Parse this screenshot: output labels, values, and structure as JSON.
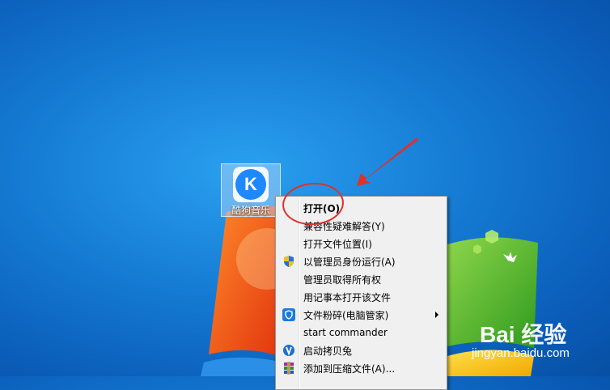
{
  "desktop": {
    "icon_label": "酷狗音乐",
    "icon_letter": "K"
  },
  "context_menu": {
    "items": [
      {
        "label": "打开(O)",
        "icon": "none",
        "bold": true
      },
      {
        "label": "兼容性疑难解答(Y)",
        "icon": "none"
      },
      {
        "label": "打开文件位置(I)",
        "icon": "none"
      },
      {
        "label": "以管理员身份运行(A)",
        "icon": "uac-shield-icon"
      },
      {
        "label": "管理员取得所有权",
        "icon": "none"
      },
      {
        "label": "用记事本打开该文件",
        "icon": "none"
      },
      {
        "label": "文件粉碎(电脑管家)",
        "icon": "tencent-shield-icon",
        "submenu": true
      },
      {
        "label": "start commander",
        "icon": "none"
      },
      {
        "label": "启动拷贝兔",
        "icon": "copy-rabbit-icon"
      },
      {
        "label": "添加到压缩文件(A)...",
        "icon": "winrar-icon"
      }
    ]
  },
  "watermark": {
    "brand": "Bai 经验",
    "url": "jingyan.baidu.com"
  },
  "colors": {
    "annotation_red": "#e0302a",
    "desktop_blue": "#1479d2"
  }
}
